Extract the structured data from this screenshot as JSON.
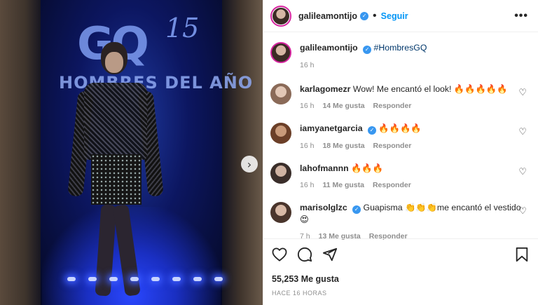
{
  "photo": {
    "logo_text": "GQ",
    "logo_number": "15",
    "banner_text": "HOMBRES DEL AÑO",
    "next_icon": "chevron-right-icon"
  },
  "header": {
    "username": "galileamontijo",
    "verified_icon": "verified-badge-icon",
    "separator": "•",
    "follow_label": "Seguir",
    "more_icon": "more-options-icon",
    "more_label": "•••"
  },
  "caption": {
    "username": "galileamontijo",
    "text": "#HombresGQ",
    "time": "16 h"
  },
  "comments": [
    {
      "username": "karlagomezr",
      "verified": false,
      "text": "Wow! Me encantó el look! 🔥🔥🔥🔥🔥",
      "time": "16 h",
      "likes": "14 Me gusta",
      "reply": "Responder"
    },
    {
      "username": "iamyanetgarcia",
      "verified": true,
      "text": "🔥🔥🔥🔥",
      "time": "16 h",
      "likes": "18 Me gusta",
      "reply": "Responder"
    },
    {
      "username": "lahofmannn",
      "verified": false,
      "text": "🔥🔥🔥",
      "time": "16 h",
      "likes": "11 Me gusta",
      "reply": "Responder"
    },
    {
      "username": "marisolglzc",
      "verified": true,
      "text": "Guapisma 👏👏👏me encantó el vestido 😍",
      "time": "7 h",
      "likes": "13 Me gusta",
      "reply": "Responder"
    }
  ],
  "actions": {
    "like_icon": "heart-icon",
    "comment_icon": "comment-icon",
    "share_icon": "share-icon",
    "save_icon": "bookmark-icon",
    "likes_count": "55,253 Me gusta",
    "timestamp": "HACE 16 HORAS"
  },
  "colors": {
    "accent": "#0095f6",
    "verified": "#3897f0",
    "muted": "#8e8e8e",
    "hashtag": "#00376b"
  }
}
